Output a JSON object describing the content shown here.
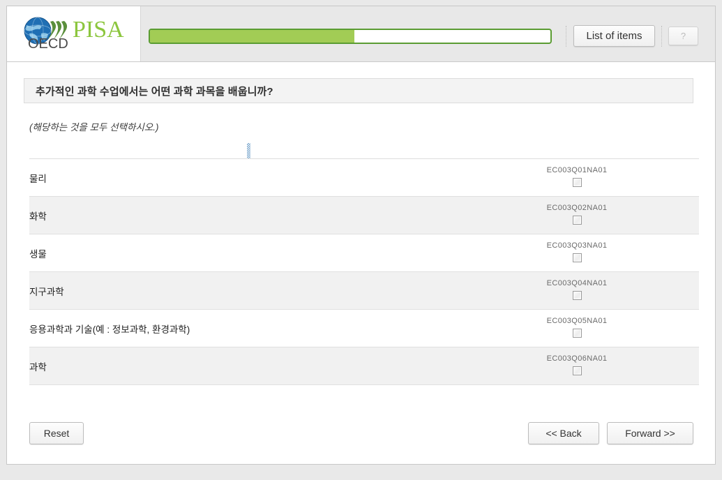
{
  "header": {
    "logo": {
      "brand": "PISA",
      "org": "OECD",
      "globe_icon": "globe-icon",
      "swoosh_icon": "swoosh-icon"
    },
    "progress": {
      "percent": 51,
      "fill_color": "#a2cc55",
      "border_color": "#5a9c32"
    },
    "list_of_items_label": "List of items",
    "help_label": "?"
  },
  "question": {
    "title": "추가적인 과학 수업에서는 어떤 과학 과목을 배웁니까?",
    "instruction": "(해당하는 것을 모두 선택하시오.)"
  },
  "options": [
    {
      "label": "물리",
      "code": "EC003Q01NA01",
      "checked": false
    },
    {
      "label": "화학",
      "code": "EC003Q02NA01",
      "checked": false
    },
    {
      "label": "생물",
      "code": "EC003Q03NA01",
      "checked": false
    },
    {
      "label": "지구과학",
      "code": "EC003Q04NA01",
      "checked": false
    },
    {
      "label": "응용과학과 기술(예 : 정보과학, 환경과학)",
      "code": "EC003Q05NA01",
      "checked": false
    },
    {
      "label": "과학",
      "code": "EC003Q06NA01",
      "checked": false
    }
  ],
  "footer": {
    "reset_label": "Reset",
    "back_label": "<< Back",
    "forward_label": "Forward >>"
  }
}
